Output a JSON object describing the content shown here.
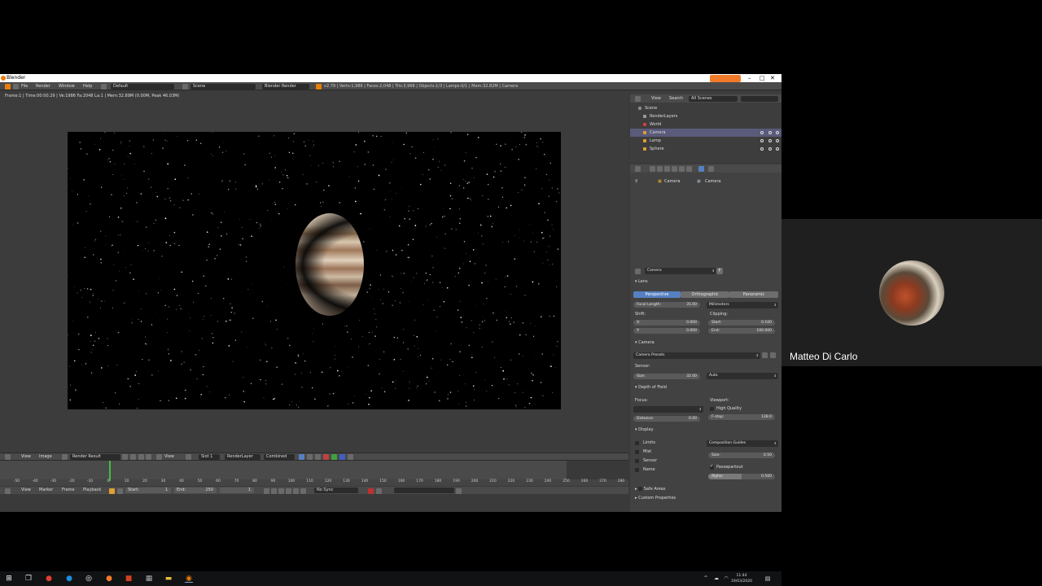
{
  "window": {
    "title": "Blender"
  },
  "menubar": {
    "items": [
      "File",
      "Render",
      "Window",
      "Help"
    ],
    "screen_layout": "Default",
    "scene": "Scene",
    "render_engine": "Blender Render",
    "stats": "v2.79 | Verts:1,986 | Faces:2,048 | Tris:3,968 | Objects:1/3 | Lamps:0/1 | Mem:32.82M | Camera"
  },
  "viewport": {
    "info": "Frame:1 | Time:00:00.29 | Ve:1986 Fa:2048 La:1 | Mem:32.89M (0.00M, Peak 46.03M)"
  },
  "image_editor_header": {
    "items": [
      "View",
      "Image"
    ],
    "image_name": "Render Result",
    "view_label": "View",
    "slot": "Slot 1",
    "layer": "RenderLayer",
    "pass": "Combined"
  },
  "timeline": {
    "ticks": [
      "-50",
      "-40",
      "-30",
      "-20",
      "-10",
      "0",
      "10",
      "20",
      "30",
      "40",
      "50",
      "60",
      "70",
      "80",
      "90",
      "100",
      "110",
      "120",
      "130",
      "140",
      "150",
      "160",
      "170",
      "180",
      "190",
      "200",
      "210",
      "220",
      "230",
      "240",
      "250",
      "260",
      "270",
      "280"
    ],
    "current_frame": 1,
    "header": {
      "items": [
        "View",
        "Marker",
        "Frame",
        "Playback"
      ],
      "start_label": "Start:",
      "start_value": "1",
      "end_label": "End:",
      "end_value": "250",
      "frame_value": "1",
      "sync": "No Sync"
    }
  },
  "outliner": {
    "header": {
      "view": "View",
      "search": "Search",
      "scenes": "All Scenes"
    },
    "rows": [
      {
        "label": "Scene",
        "color": "#8a8a8a",
        "selected": false,
        "eyes": false
      },
      {
        "label": "RenderLayers",
        "color": "#9a9a9a",
        "selected": false,
        "eyes": false
      },
      {
        "label": "World",
        "color": "#d04040",
        "selected": false,
        "eyes": false
      },
      {
        "label": "Camera",
        "color": "#e0a030",
        "selected": true,
        "eyes": true
      },
      {
        "label": "Lamp",
        "color": "#e0a030",
        "selected": false,
        "eyes": true
      },
      {
        "label": "Sphere",
        "color": "#e0a030",
        "selected": false,
        "eyes": true
      }
    ]
  },
  "properties": {
    "breadcrumb": [
      "Camera",
      "Camera"
    ],
    "datablock": "Camera",
    "datablock_fake": "F",
    "lens": {
      "title": "Lens",
      "types": [
        "Perspective",
        "Orthographic",
        "Panoramic"
      ],
      "focal_label": "Focal Length:",
      "focal_value": "35.00",
      "unit": "Millimeters",
      "shift_label": "Shift:",
      "shift_x_label": "X:",
      "shift_x": "0.000",
      "shift_y_label": "Y:",
      "shift_y": "0.000",
      "clipping_label": "Clipping:",
      "clip_start_label": "Start:",
      "clip_start": "0.100",
      "clip_end_label": "End:",
      "clip_end": "100.000"
    },
    "camera": {
      "title": "Camera",
      "presets": "Camera Presets",
      "sensor_label": "Sensor:",
      "size_label": "Size:",
      "size_value": "32.00",
      "fit": "Auto"
    },
    "dof": {
      "title": "Depth of Field",
      "focus_label": "Focus:",
      "distance_label": "Distance:",
      "distance_value": "0.00",
      "viewport_label": "Viewport:",
      "high_quality": "High Quality",
      "fstop_label": "F-stop:",
      "fstop_value": "128.0"
    },
    "display": {
      "title": "Display",
      "checks": [
        "Limits",
        "Mist",
        "Sensor",
        "Name"
      ],
      "guides": "Composition Guides",
      "size_label": "Size:",
      "size_value": "0.50",
      "passepartout": "Passepartout",
      "alpha_label": "Alpha:",
      "alpha_value": "0.500",
      "alpha_fraction": 0.5
    },
    "safe_areas": "Safe Areas",
    "custom_props": "Custom Properties"
  },
  "taskbar": {
    "time": "11:44",
    "date": "19/03/2020"
  },
  "participant": {
    "name": "Matteo Di Carlo"
  }
}
